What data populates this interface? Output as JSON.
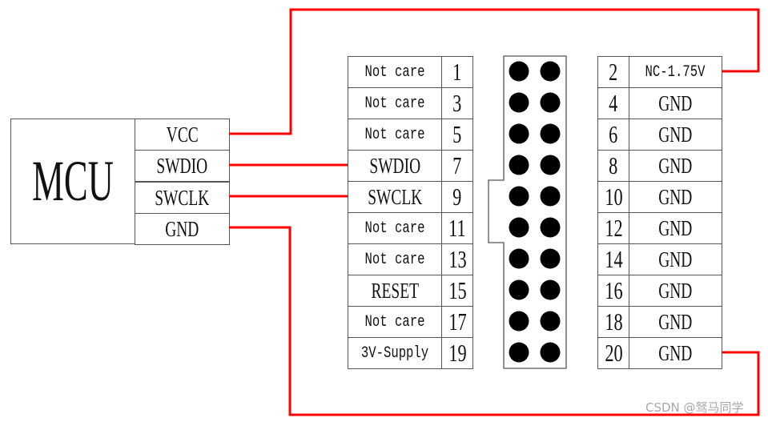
{
  "mcu": {
    "label": "MCU",
    "pins": [
      {
        "name": "VCC"
      },
      {
        "name": "SWDIO"
      },
      {
        "name": "SWCLK"
      },
      {
        "name": "GND"
      }
    ]
  },
  "header_left": [
    {
      "label": "Not care",
      "pin": "1"
    },
    {
      "label": "Not care",
      "pin": "3"
    },
    {
      "label": "Not care",
      "pin": "5"
    },
    {
      "label": "SWDIO",
      "pin": "7"
    },
    {
      "label": "SWCLK",
      "pin": "9"
    },
    {
      "label": "Not care",
      "pin": "11"
    },
    {
      "label": "Not care",
      "pin": "13"
    },
    {
      "label": "RESET",
      "pin": "15"
    },
    {
      "label": "Not care",
      "pin": "17"
    },
    {
      "label": "3V-Supply",
      "pin": "19"
    }
  ],
  "header_right": [
    {
      "pin": "2",
      "label": "NC-1.75V"
    },
    {
      "pin": "4",
      "label": "GND"
    },
    {
      "pin": "6",
      "label": "GND"
    },
    {
      "pin": "8",
      "label": "GND"
    },
    {
      "pin": "10",
      "label": "GND"
    },
    {
      "pin": "12",
      "label": "GND"
    },
    {
      "pin": "14",
      "label": "GND"
    },
    {
      "pin": "16",
      "label": "GND"
    },
    {
      "pin": "18",
      "label": "GND"
    },
    {
      "pin": "20",
      "label": "GND"
    }
  ],
  "connector": {
    "rows": 10,
    "columns": 2,
    "keyed": true
  },
  "connections": [
    {
      "from": "MCU.VCC",
      "to": "pin 2 (NC-1.75V)"
    },
    {
      "from": "MCU.SWDIO",
      "to": "pin 7 (SWDIO)"
    },
    {
      "from": "MCU.SWCLK",
      "to": "pin 9 (SWCLK)"
    },
    {
      "from": "MCU.GND",
      "to": "pin 20 (GND)"
    }
  ],
  "colors": {
    "wire": "#ff0000",
    "outline": "#555555",
    "pin_dot": "#000000",
    "watermark": "#a8a8a8"
  },
  "watermark": "CSDN @驽马同学"
}
